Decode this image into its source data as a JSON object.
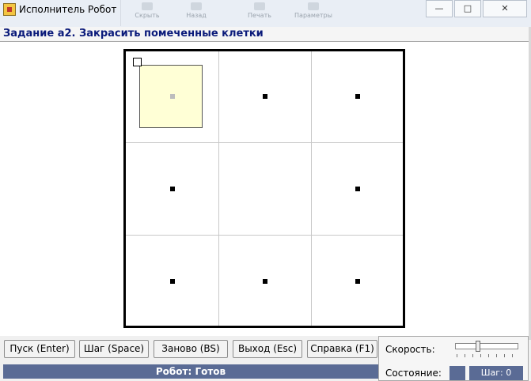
{
  "window": {
    "title": "Исполнитель Робот",
    "toolbar_ghost_labels": [
      "Скрыть",
      "Назад",
      "Печать",
      "Параметры"
    ],
    "controls": {
      "minimize": "—",
      "maximize": "□",
      "close": "✕"
    }
  },
  "task": {
    "label": "Задание а2. Закрасить помеченные клетки"
  },
  "field": {
    "rows": 3,
    "cols": 3,
    "robot_cell": [
      0,
      0
    ],
    "painted_cells": [
      [
        0,
        0
      ]
    ],
    "marked_cells": [
      [
        0,
        0
      ],
      [
        0,
        1
      ],
      [
        0,
        2
      ],
      [
        1,
        0
      ],
      [
        1,
        2
      ],
      [
        2,
        0
      ],
      [
        2,
        1
      ],
      [
        2,
        2
      ]
    ]
  },
  "buttons": {
    "start": "Пуск (Enter)",
    "step": "Шаг (Space)",
    "reset": "Заново (BS)",
    "exit": "Выход (Esc)",
    "help": "Справка (F1)"
  },
  "status": {
    "text": "Робот: Готов"
  },
  "panel": {
    "speed_label": "Скорость:",
    "state_label": "Состояние:",
    "step_counter": "Шаг: 0"
  },
  "colors": {
    "accent": "#5a6b95",
    "paint": "#ffffd6",
    "task_text": "#0a1a7a"
  }
}
